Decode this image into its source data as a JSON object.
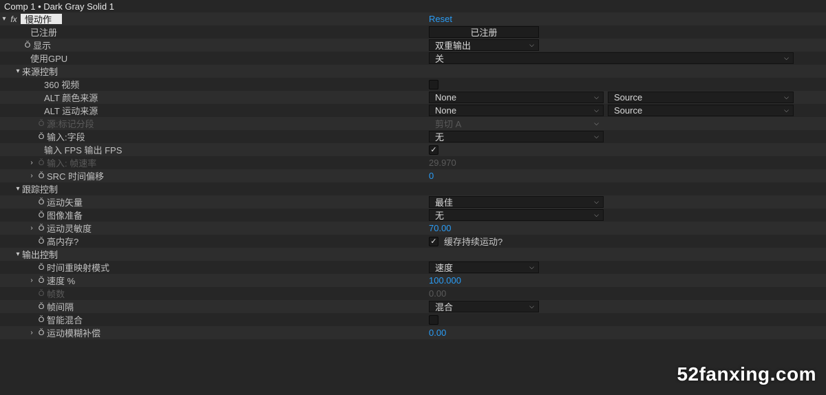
{
  "panel": {
    "breadcrumb": "Comp 1 • Dark Gray Solid 1"
  },
  "effect": {
    "name": "慢动作",
    "reset": "Reset"
  },
  "props": {
    "registered": {
      "label": "已注册",
      "value": "已注册"
    },
    "display": {
      "label": "显示",
      "value": "双重输出"
    },
    "use_gpu": {
      "label": "使用GPU",
      "value": "关"
    }
  },
  "source_control": {
    "label": "来源控制",
    "video360": {
      "label": "360 视频"
    },
    "alt_color": {
      "label": "ALT 颜色来源",
      "value": "None",
      "source": "Source"
    },
    "alt_motion": {
      "label": "ALT 运动来源",
      "value": "None",
      "source": "Source"
    },
    "marker_seg": {
      "label": "源:标记分段",
      "value": "剪切 A"
    },
    "input_field": {
      "label": "输入:字段",
      "value": "无"
    },
    "fps_io": {
      "label": "输入 FPS 输出 FPS"
    },
    "input_rate": {
      "label": "输入: 帧速率",
      "value": "29.970"
    },
    "src_offset": {
      "label": "SRC 时间偏移",
      "value": "0"
    }
  },
  "track_control": {
    "label": "跟踪控制",
    "motion_vec": {
      "label": "运动矢量",
      "value": "最佳"
    },
    "image_prep": {
      "label": "图像准备",
      "value": "无"
    },
    "motion_sens": {
      "label": "运动灵敏度",
      "value": "70.00"
    },
    "high_mem": {
      "label": "高内存?",
      "check_label": "缓存持续运动?"
    }
  },
  "output_control": {
    "label": "输出控制",
    "time_remap": {
      "label": "时间重映射模式",
      "value": "速度"
    },
    "speed_pct": {
      "label": "速度 %",
      "value": "100.000"
    },
    "frames": {
      "label": "帧数",
      "value": "0.00"
    },
    "frame_int": {
      "label": "帧间隔",
      "value": "混合"
    },
    "smart_blend": {
      "label": "智能混合"
    },
    "motion_blur": {
      "label": "运动模糊补偿",
      "value": "0.00"
    }
  },
  "watermark": "52fanxing.com"
}
